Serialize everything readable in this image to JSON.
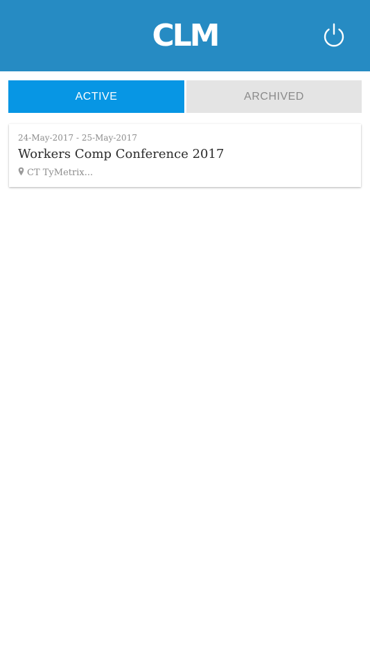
{
  "header": {
    "logo_text": "CLM",
    "power_icon": "power-icon",
    "background": "#268bc3"
  },
  "tabs": [
    {
      "label": "ACTIVE",
      "selected": true,
      "color": "#0796e4"
    },
    {
      "label": "ARCHIVED",
      "selected": false,
      "color": "#e4e4e4"
    }
  ],
  "events": [
    {
      "dates": "24-May-2017 - 25-May-2017",
      "title": "Workers Comp Conference 2017",
      "location": "CT TyMetrix...",
      "location_icon": "map-pin-icon"
    }
  ]
}
